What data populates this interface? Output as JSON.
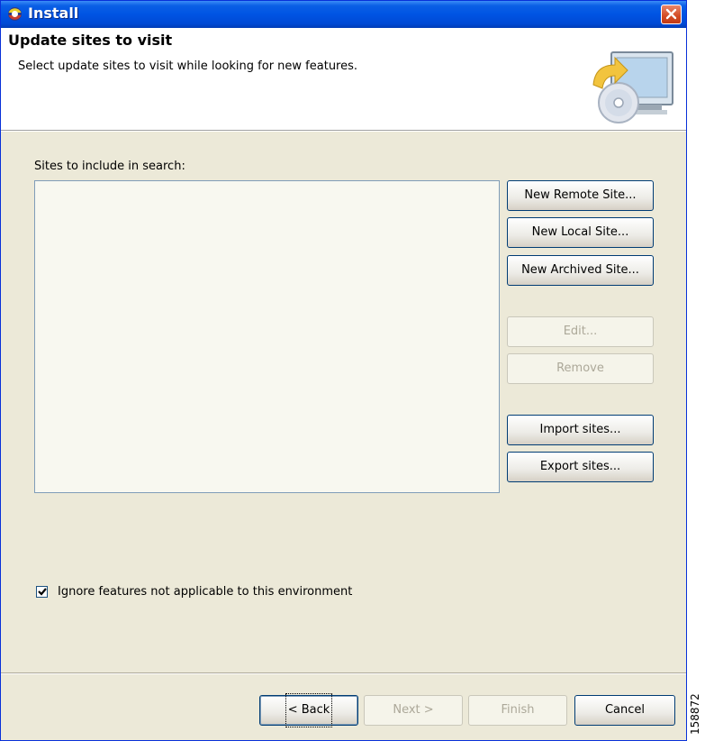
{
  "window": {
    "title": "Install"
  },
  "header": {
    "title": "Update sites to visit",
    "description": "Select update sites to visit while looking for new features."
  },
  "sites": {
    "label": "Sites to include in search:",
    "items": []
  },
  "buttons": {
    "new_remote_site": "New Remote Site...",
    "new_local_site": "New Local Site...",
    "new_archived_site": "New Archived Site...",
    "edit": "Edit...",
    "remove": "Remove",
    "import_sites": "Import sites...",
    "export_sites": "Export sites..."
  },
  "options": {
    "ignore_features_label": "Ignore features not applicable to this environment",
    "ignore_features_checked": true
  },
  "footer": {
    "back": "< Back",
    "next": "Next >",
    "finish": "Finish",
    "cancel": "Cancel"
  },
  "figure_number": "158872",
  "colors": {
    "titlebar": "#0054E3",
    "dialog_bg": "#ECE9D8",
    "disabled_text": "#ACA899"
  }
}
